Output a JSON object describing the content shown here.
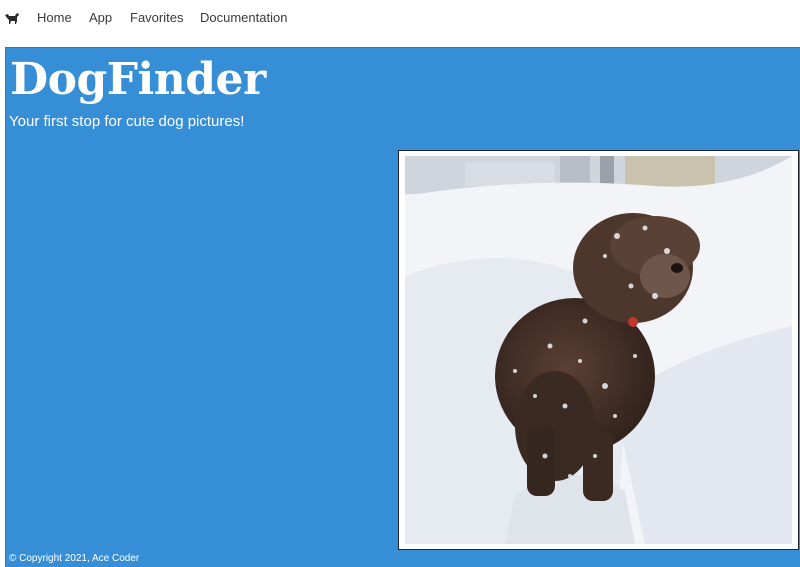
{
  "nav": {
    "logo_icon": "dog-icon",
    "items": [
      {
        "label": "Home"
      },
      {
        "label": "App"
      },
      {
        "label": "Favorites"
      },
      {
        "label": "Documentation"
      }
    ]
  },
  "hero": {
    "title": "DogFinder",
    "tagline": "Your first stop for cute dog pictures!",
    "background_color": "#368fd6",
    "image": {
      "subject": "brown curly dog in snow",
      "icon": "dog-photo"
    }
  },
  "footer": {
    "copyright": "© Copyright 2021, Ace Coder"
  }
}
